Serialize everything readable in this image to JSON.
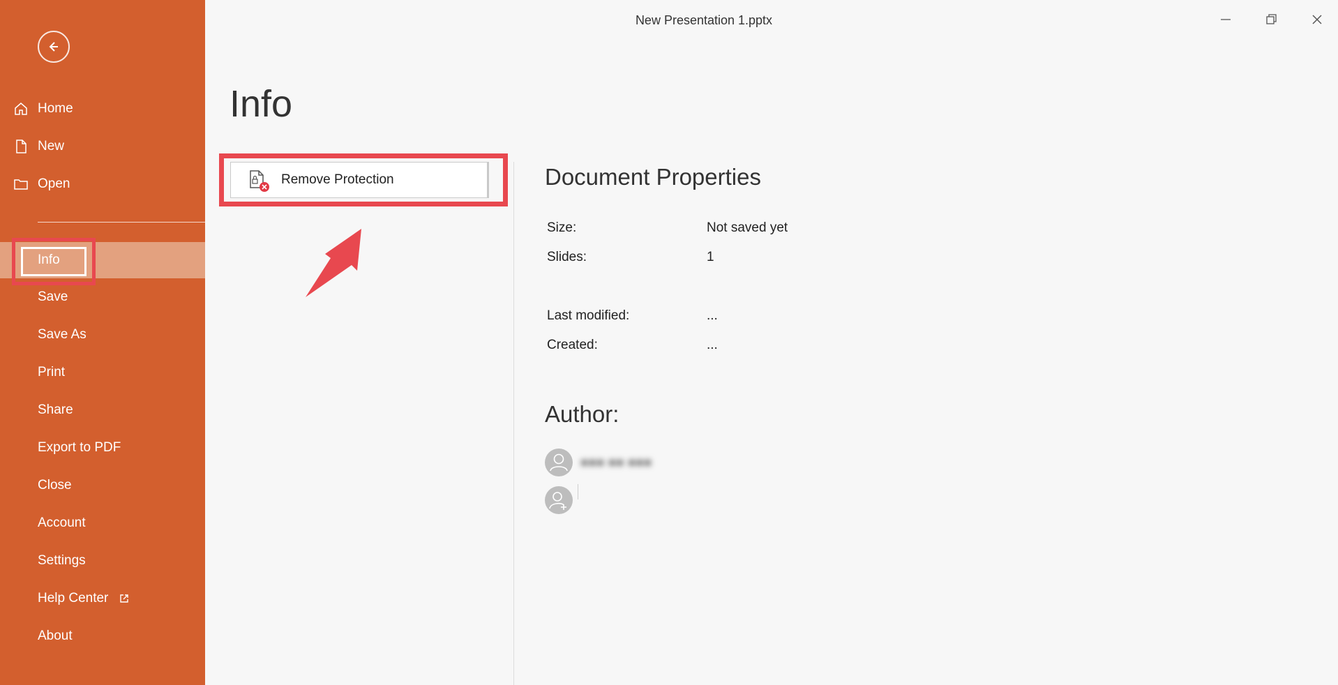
{
  "window": {
    "title": "New Presentation 1.pptx"
  },
  "sidebar": {
    "accent_color": "#d35f2e",
    "items": [
      {
        "label": "Home",
        "icon": "home-icon"
      },
      {
        "label": "New",
        "icon": "new-file-icon"
      },
      {
        "label": "Open",
        "icon": "folder-icon"
      },
      {
        "label": "Info"
      },
      {
        "label": "Save"
      },
      {
        "label": "Save As"
      },
      {
        "label": "Print"
      },
      {
        "label": "Share"
      },
      {
        "label": "Export to PDF"
      },
      {
        "label": "Close"
      },
      {
        "label": "Account"
      },
      {
        "label": "Settings"
      },
      {
        "label": "Help Center",
        "icon": "external-link-icon"
      },
      {
        "label": "About"
      }
    ]
  },
  "main": {
    "page_title": "Info",
    "remove_protection_label": "Remove Protection",
    "properties": {
      "title": "Document Properties",
      "rows": [
        {
          "label": "Size:",
          "value": "Not saved yet"
        },
        {
          "label": "Slides:",
          "value": "1"
        },
        {
          "label": "Last modified:",
          "value": "..."
        },
        {
          "label": "Created:",
          "value": "..."
        }
      ]
    },
    "author": {
      "title": "Author:",
      "name": "■■■ ■■ ■■■"
    }
  },
  "annotations": {
    "highlight_color": "#e8484f"
  }
}
